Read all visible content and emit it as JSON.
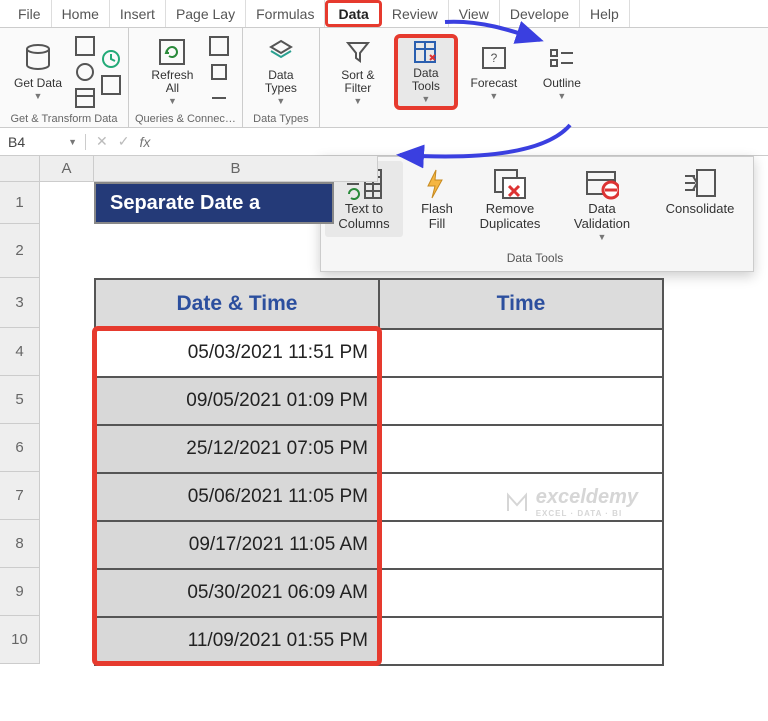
{
  "menu": {
    "tabs": [
      "File",
      "Home",
      "Insert",
      "Page Lay",
      "Formulas",
      "Data",
      "Review",
      "View",
      "Develope",
      "Help"
    ],
    "active": "Data"
  },
  "ribbon": {
    "group1": {
      "caption": "Get & Transform Data",
      "get_data": "Get Data"
    },
    "group2": {
      "caption": "Queries & Connec…",
      "refresh": "Refresh All"
    },
    "group3": {
      "caption": "Data Types",
      "types": "Data Types"
    },
    "sortfilter": "Sort & Filter",
    "datatools": "Data Tools",
    "forecast": "Forecast",
    "outline": "Outline"
  },
  "ribbon2": {
    "caption": "Data Tools",
    "text_to_columns": "Text to Columns",
    "flash_fill": "Flash Fill",
    "remove_dup": "Remove Duplicates",
    "data_validation": "Data Validation",
    "consolidate": "Consolidate"
  },
  "namebox": "B4",
  "columns": [
    "A",
    "B"
  ],
  "rows": [
    "1",
    "2",
    "3",
    "4",
    "5",
    "6",
    "7",
    "8",
    "9",
    "10"
  ],
  "title_cell": "Separate Date a",
  "table": {
    "headers": [
      "Date & Time",
      "Time"
    ],
    "rows": [
      "05/03/2021 11:51 PM",
      "09/05/2021 01:09 PM",
      "25/12/2021  07:05 PM",
      "05/06/2021 11:05 PM",
      "09/17/2021 11:05 AM",
      "05/30/2021 06:09 AM",
      "11/09/2021 01:55 PM"
    ]
  },
  "watermark": {
    "text": "exceldemy",
    "sub": "EXCEL · DATA · BI"
  }
}
